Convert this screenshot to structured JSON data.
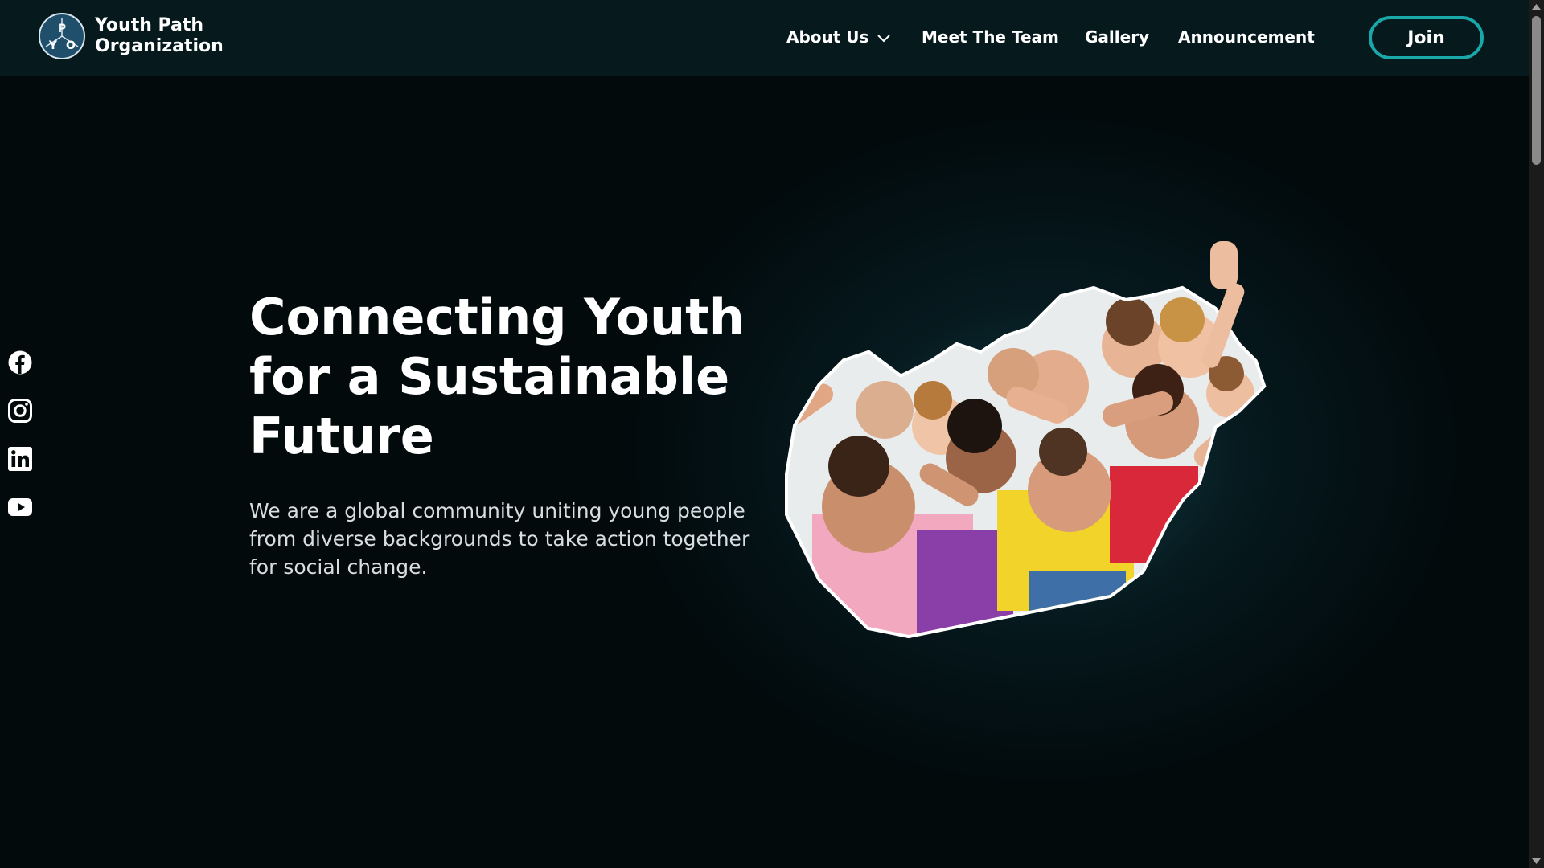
{
  "brand": {
    "name_line1": "Youth Path",
    "name_line2": "Organization",
    "logo_letters": [
      "P",
      "Y",
      "O"
    ]
  },
  "nav": {
    "about": "About Us",
    "team": "Meet The Team",
    "gallery": "Gallery",
    "announcement": "Announcement"
  },
  "join_label": "Join",
  "social": [
    {
      "icon": "facebook-icon"
    },
    {
      "icon": "instagram-icon"
    },
    {
      "icon": "linkedin-icon"
    },
    {
      "icon": "youtube-icon"
    }
  ],
  "hero": {
    "title": "Connecting Youth for a Sustainable Future",
    "subtitle": "We are a global community uniting young people from diverse backgrounds to take action together for social change."
  },
  "colors": {
    "background": "#020a0c",
    "header": "#06191d",
    "accent": "#1aa7a9",
    "text": "#ffffff"
  }
}
